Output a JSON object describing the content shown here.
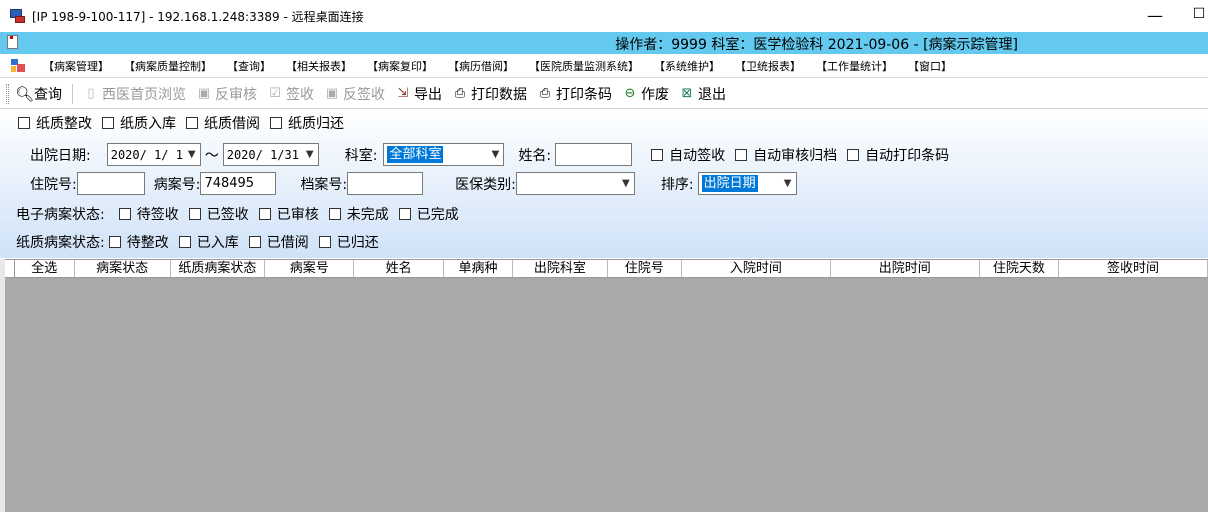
{
  "window": {
    "title": "[IP 198-9-100-117] - 192.168.1.248:3389 - 远程桌面连接",
    "minimize": "—",
    "maximize": "☐"
  },
  "caption": "操作者：9999  科室：医学检验科  2021-09-06 - [病案示踪管理]",
  "menu": [
    "【病案管理】",
    "【病案质量控制】",
    "【查询】",
    "【相关报表】",
    "【病案复印】",
    "【病历借阅】",
    "【医院质量监测系统】",
    "【系统维护】",
    "【卫统报表】",
    "【工作量统计】",
    "【窗口】"
  ],
  "toolbar": {
    "query": "查询",
    "western_home_browse": "西医首页浏览",
    "reverse_review": "反审核",
    "sign_receive": "签收",
    "reverse_sign": "反签收",
    "export": "导出",
    "print_data": "打印数据",
    "print_barcode": "打印条码",
    "void": "作废",
    "exit": "退出"
  },
  "paper_actions": [
    "纸质整改",
    "纸质入库",
    "纸质借阅",
    "纸质归还"
  ],
  "filters": {
    "discharge_date_label": "出院日期:",
    "date_from": "2020/ 1/ 1",
    "date_sep": "～",
    "date_to": "2020/ 1/31",
    "dept_label": "科室:",
    "dept_value": "全部科室",
    "name_label": "姓名:",
    "name_value": "",
    "auto_sign": "自动签收",
    "auto_review_archive": "自动审核归档",
    "auto_print_barcode": "自动打印条码",
    "inpatient_no_label": "住院号:",
    "inpatient_no_value": "",
    "case_no_label": "病案号:",
    "case_no_value": "748495",
    "archive_no_label": "档案号:",
    "archive_no_value": "",
    "insurance_label": "医保类别:",
    "insurance_value": "",
    "sort_label": "排序:",
    "sort_value": "出院日期"
  },
  "e_status": {
    "label": "电子病案状态:",
    "options": [
      "待签收",
      "已签收",
      "已审核",
      "未完成",
      "已完成"
    ]
  },
  "paper_status": {
    "label": "纸质病案状态:",
    "options": [
      "待整改",
      "已入库",
      "已借阅",
      "已归还"
    ]
  },
  "grid": {
    "columns": [
      "全选",
      "病案状态",
      "纸质病案状态",
      "病案号",
      "姓名",
      "单病种",
      "出院科室",
      "住院号",
      "入院时间",
      "出院时间",
      "住院天数",
      "签收时间"
    ]
  }
}
